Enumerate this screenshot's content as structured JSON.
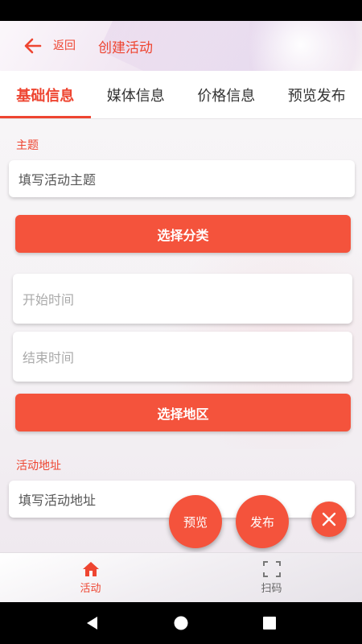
{
  "header": {
    "back_label": "返回",
    "title": "创建活动"
  },
  "tabs": [
    {
      "label": "基础信息",
      "active": true
    },
    {
      "label": "媒体信息",
      "active": false
    },
    {
      "label": "价格信息",
      "active": false
    },
    {
      "label": "预览发布",
      "active": false
    }
  ],
  "form": {
    "topic_label": "主题",
    "topic_placeholder": "填写活动主题",
    "category_button": "选择分类",
    "start_time_placeholder": "开始时间",
    "end_time_placeholder": "结束时间",
    "region_button": "选择地区",
    "address_label": "活动地址",
    "address_placeholder": "填写活动地址"
  },
  "fabs": {
    "preview": "预览",
    "publish": "发布"
  },
  "bottom_nav": [
    {
      "label": "活动",
      "icon": "home-icon",
      "active": true
    },
    {
      "label": "扫码",
      "icon": "scan-icon",
      "active": false
    }
  ],
  "colors": {
    "accent": "#ee4531",
    "button": "#f4533c"
  }
}
